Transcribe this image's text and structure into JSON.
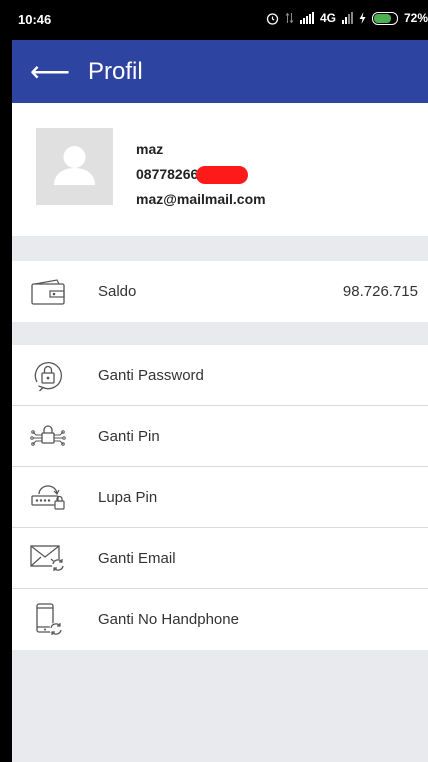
{
  "status_bar": {
    "time": "10:46",
    "network": "4G",
    "battery": "72%"
  },
  "app_bar": {
    "title": "Profil"
  },
  "profile": {
    "name": "maz",
    "phone": "08778266",
    "email": "maz@mailmail.com"
  },
  "balance": {
    "label": "Saldo",
    "value": "98.726.715"
  },
  "menu": [
    {
      "label": "Ganti Password",
      "icon": "lock-refresh-icon"
    },
    {
      "label": "Ganti Pin",
      "icon": "pin-circuit-icon"
    },
    {
      "label": "Lupa Pin",
      "icon": "keyboard-lock-icon"
    },
    {
      "label": "Ganti Email",
      "icon": "envelope-refresh-icon"
    },
    {
      "label": "Ganti No Handphone",
      "icon": "phone-refresh-icon"
    }
  ]
}
